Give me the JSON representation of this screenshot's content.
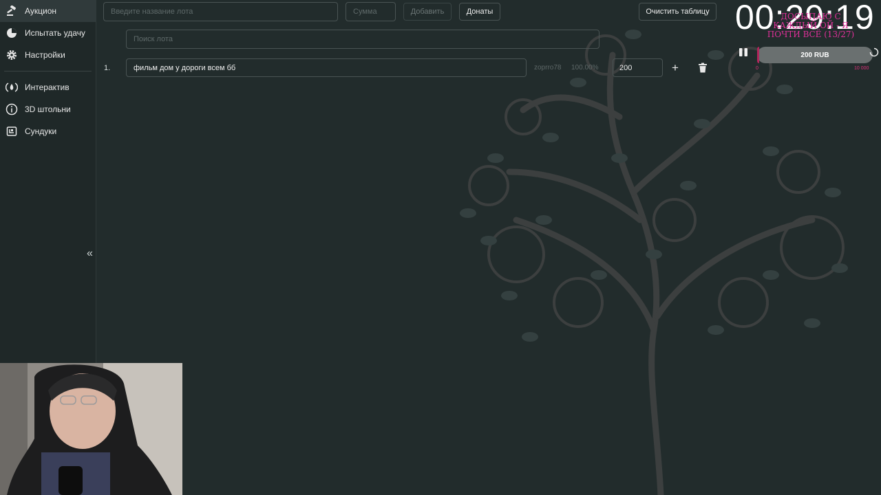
{
  "sidebar": {
    "items": [
      {
        "label": "Аукцион",
        "icon": "gavel-icon"
      },
      {
        "label": "Испытать удачу",
        "icon": "pie-chart-icon"
      },
      {
        "label": "Настройки",
        "icon": "gear-icon"
      },
      {
        "label": "Интерактив",
        "icon": "flame-icon"
      },
      {
        "label": "3D штольни",
        "icon": "info-icon"
      },
      {
        "label": "Сундуки",
        "icon": "chest-icon"
      }
    ],
    "collapse_label": "«"
  },
  "toolbar": {
    "lot_placeholder": "Введите название лота",
    "sum_placeholder": "Сумма",
    "add_label": "Добавить",
    "donations_label": "Донаты",
    "clear_label": "Очистить таблицу",
    "search_placeholder": "Поиск лота"
  },
  "lots": [
    {
      "index": "1.",
      "name": "фильм дом у дороги всем бб",
      "user": "zoprro78",
      "percent": "100.00%",
      "amount": "200"
    }
  ],
  "timer": {
    "value": "00:29:19"
  },
  "overlay": {
    "line1": "ДОСЫПАЮ С",
    "line2": "КАЖДЫЙ ОЙ - Я",
    "line3": "ПОЧТИ ВСЁ (13/27)"
  },
  "slider": {
    "label": "200 RUB",
    "min": "0",
    "max": "10 000",
    "value": 200,
    "max_value": 10000
  },
  "colors": {
    "accent": "#b0265c",
    "overlay": "#e0309a",
    "background": "#222c2c"
  }
}
